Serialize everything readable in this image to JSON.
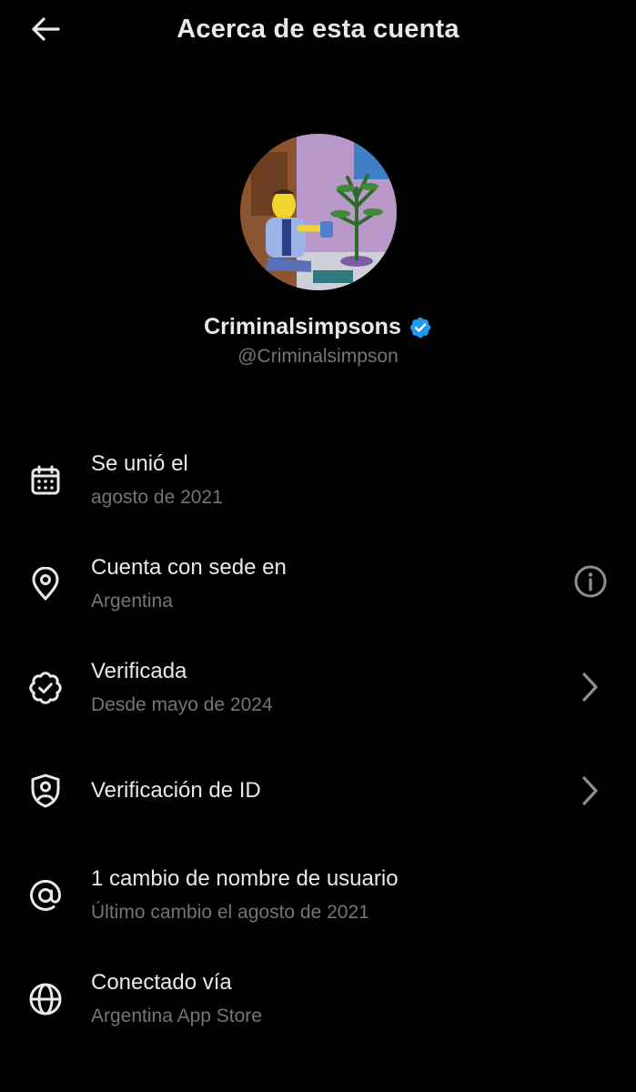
{
  "header": {
    "title": "Acerca de esta cuenta",
    "back_icon": "arrow-left-icon"
  },
  "profile": {
    "display_name": "Criminalsimpsons",
    "handle": "@Criminalsimpson",
    "verified": true,
    "badge_color": "#1d9bf0"
  },
  "details": [
    {
      "icon": "calendar-icon",
      "title": "Se unió el",
      "subtitle": "agosto de 2021",
      "trailing": null
    },
    {
      "icon": "location-pin-icon",
      "title": "Cuenta con sede en",
      "subtitle": "Argentina",
      "trailing": "info-icon"
    },
    {
      "icon": "verified-outline-icon",
      "title": "Verificada",
      "subtitle": "Desde mayo de 2024",
      "trailing": "chevron-right-icon"
    },
    {
      "icon": "shield-user-icon",
      "title": "Verificación de ID",
      "subtitle": "",
      "trailing": "chevron-right-icon"
    },
    {
      "icon": "at-sign-icon",
      "title": "1 cambio de nombre de usuario",
      "subtitle": "Último cambio el agosto de 2021",
      "trailing": null
    },
    {
      "icon": "globe-icon",
      "title": "Conectado vía",
      "subtitle": "Argentina App Store",
      "trailing": null
    }
  ],
  "colors": {
    "background": "#000000",
    "primary_text": "#e7e9ea",
    "secondary_text": "#71767b"
  }
}
